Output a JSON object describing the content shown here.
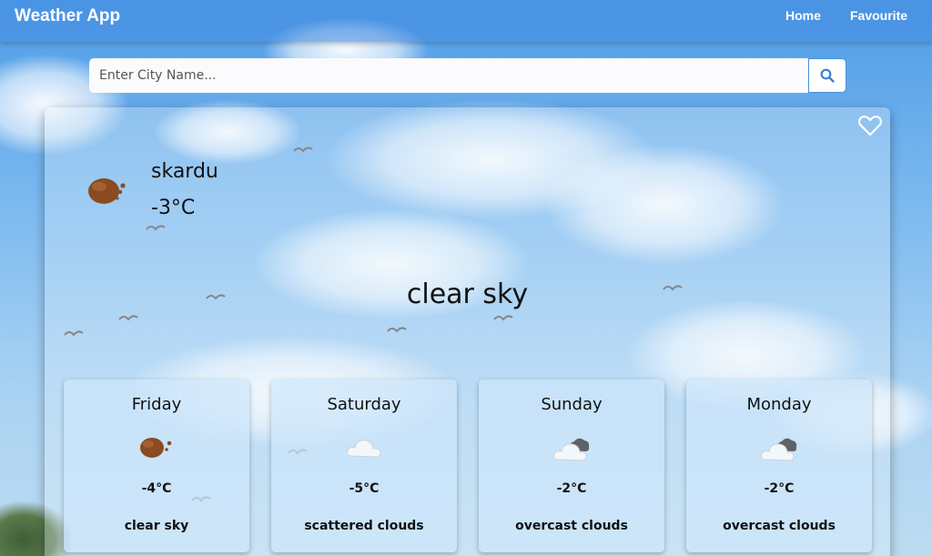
{
  "navbar": {
    "brand": "Weather App",
    "links": [
      "Home",
      "Favourite"
    ]
  },
  "search": {
    "placeholder": "Enter City Name...",
    "value": ""
  },
  "current": {
    "city": "skardu",
    "temperature": "-3°C",
    "description": "clear sky",
    "icon": "clear-sky-icon"
  },
  "forecast": [
    {
      "day": "Friday",
      "temp": "-4°C",
      "desc": "clear sky",
      "icon": "clear-sky-icon"
    },
    {
      "day": "Saturday",
      "temp": "-5°C",
      "desc": "scattered clouds",
      "icon": "scattered-clouds-icon"
    },
    {
      "day": "Sunday",
      "temp": "-2°C",
      "desc": "overcast clouds",
      "icon": "overcast-clouds-icon"
    },
    {
      "day": "Monday",
      "temp": "-2°C",
      "desc": "overcast clouds",
      "icon": "overcast-clouds-icon"
    }
  ],
  "colors": {
    "navbar": "#468ce1",
    "search_border": "#4b8fd8",
    "sun_icon": "#8a4b22"
  }
}
